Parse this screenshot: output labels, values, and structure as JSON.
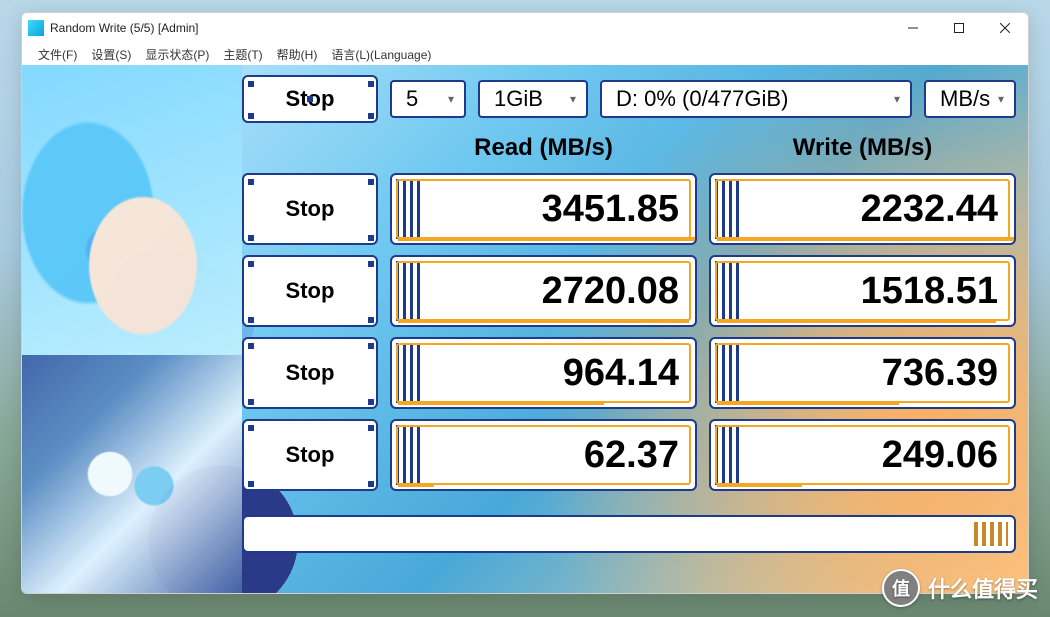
{
  "window": {
    "title": "Random Write (5/5) [Admin]"
  },
  "menu": {
    "file": "文件(F)",
    "settings": "设置(S)",
    "display": "显示状态(P)",
    "theme": "主题(T)",
    "help": "帮助(H)",
    "language": "语言(L)(Language)"
  },
  "controls": {
    "main_button": "Stop",
    "test_count": "5",
    "test_size": "1GiB",
    "drive": "D: 0% (0/477GiB)",
    "unit": "MB/s"
  },
  "headers": {
    "read": "Read (MB/s)",
    "write": "Write (MB/s)"
  },
  "rows": [
    {
      "label": "Stop",
      "read": "3451.85",
      "write": "2232.44",
      "read_pct": 100,
      "write_pct": 100
    },
    {
      "label": "Stop",
      "read": "2720.08",
      "write": "1518.51",
      "read_pct": 96,
      "write_pct": 92
    },
    {
      "label": "Stop",
      "read": "964.14",
      "write": "736.39",
      "read_pct": 68,
      "write_pct": 60
    },
    {
      "label": "Stop",
      "read": "62.37",
      "write": "249.06",
      "read_pct": 12,
      "write_pct": 28
    }
  ],
  "watermark": {
    "badge": "值",
    "text": "什么值得买"
  }
}
